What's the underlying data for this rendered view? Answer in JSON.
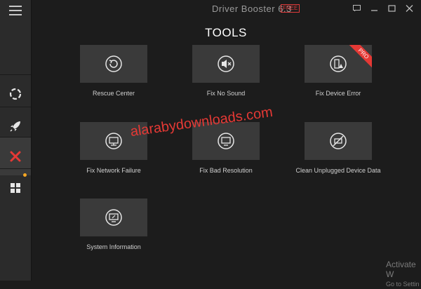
{
  "app": {
    "title": "Driver Booster 6.3",
    "badge": "FREE"
  },
  "page": {
    "title": "TOOLS"
  },
  "sidebar": {
    "items": [
      {
        "name": "scan",
        "icon": "lifebuoy-icon"
      },
      {
        "name": "boost",
        "icon": "rocket-icon"
      },
      {
        "name": "tools",
        "icon": "tools-icon",
        "active": true
      },
      {
        "name": "action-center",
        "icon": "grid-icon",
        "notification": true
      }
    ]
  },
  "tools": [
    {
      "label": "Rescue Center",
      "icon": "rescue-icon"
    },
    {
      "label": "Fix No Sound",
      "icon": "speaker-mute-icon"
    },
    {
      "label": "Fix Device Error",
      "icon": "device-error-icon",
      "badge": "PRO"
    },
    {
      "label": "Fix Network Failure",
      "icon": "network-icon"
    },
    {
      "label": "Fix Bad Resolution",
      "icon": "monitor-icon"
    },
    {
      "label": "Clean Unplugged Device Data",
      "icon": "unplugged-icon"
    },
    {
      "label": "System Information",
      "icon": "system-info-icon"
    }
  ],
  "watermark": "alarabydownloads.com",
  "activation": {
    "line1": "Activate W",
    "line2": "Go to Settin"
  },
  "colors": {
    "accent_red": "#e53935",
    "notification": "#f5a623",
    "tile": "#3a3a3a",
    "background": "#1c1c1c"
  }
}
